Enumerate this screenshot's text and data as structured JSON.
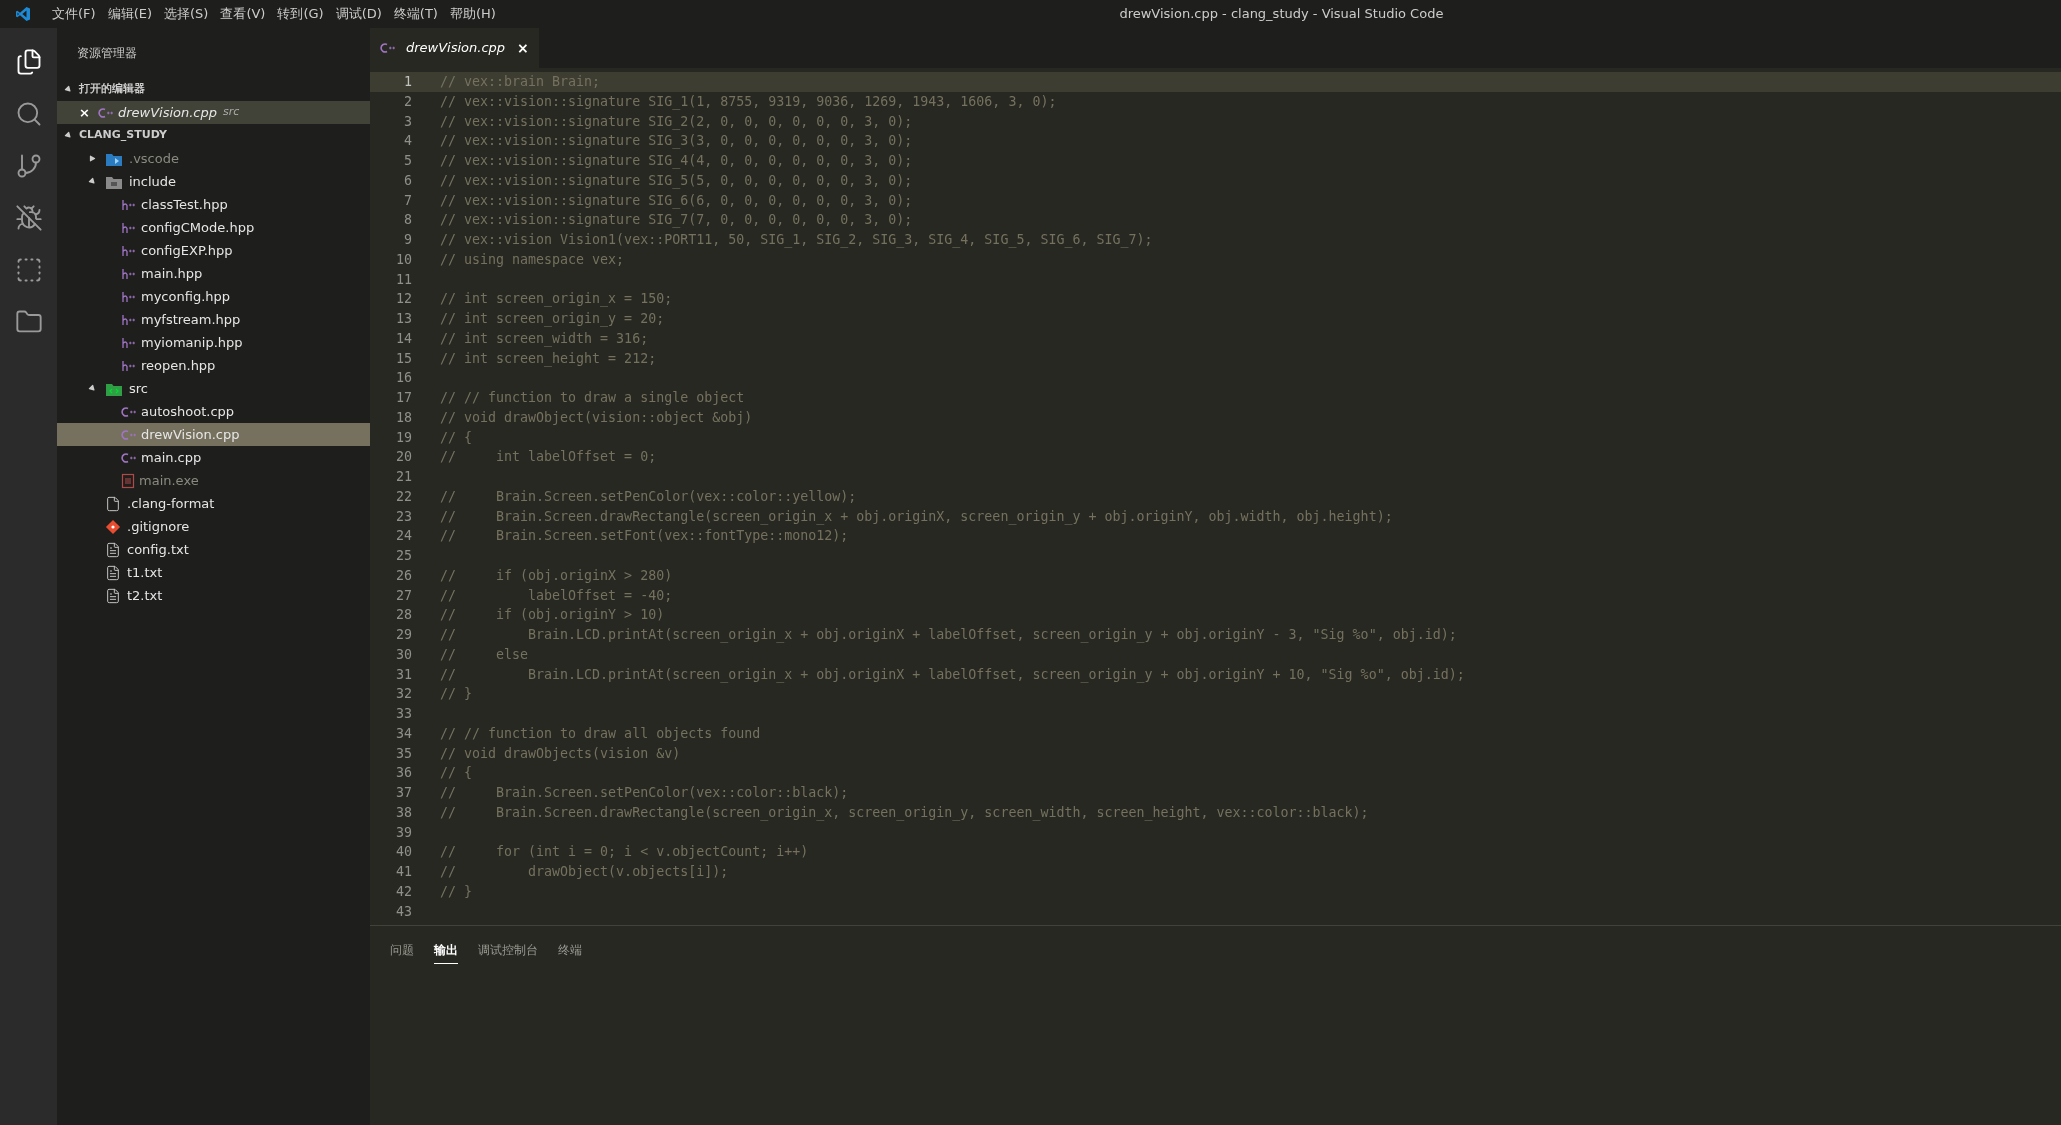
{
  "window": {
    "title": "drewVision.cpp - clang_study - Visual Studio Code"
  },
  "menu": [
    "文件(F)",
    "编辑(E)",
    "选择(S)",
    "查看(V)",
    "转到(G)",
    "调试(D)",
    "终端(T)",
    "帮助(H)"
  ],
  "activity_bar": [
    {
      "kind": "explorer",
      "selected": true
    },
    {
      "kind": "search",
      "selected": false
    },
    {
      "kind": "scm",
      "selected": false
    },
    {
      "kind": "debug",
      "selected": false
    },
    {
      "kind": "extensions",
      "selected": false
    },
    {
      "kind": "folder",
      "selected": false
    }
  ],
  "sidebar": {
    "title": "资源管理器",
    "open_editors": {
      "label": "打开的编辑器",
      "expanded": true,
      "items": [
        {
          "kind": "cpp",
          "name": "drewVision.cpp",
          "folder": "src",
          "close": "×"
        }
      ]
    },
    "project": {
      "label": "CLANG_STUDY",
      "expanded": true,
      "items": [
        {
          "kind": "vscode",
          "name": ".vscode",
          "expanded": false,
          "dim": true,
          "selected": false
        },
        {
          "kind": "folder",
          "name": "include",
          "expanded": true,
          "dim": false,
          "selected": false,
          "children": [
            {
              "kind": "hpp",
              "name": "classTest.hpp",
              "dim": false,
              "selected": false
            },
            {
              "kind": "hpp",
              "name": "configCMode.hpp",
              "dim": false,
              "selected": false
            },
            {
              "kind": "hpp",
              "name": "configEXP.hpp",
              "dim": false,
              "selected": false
            },
            {
              "kind": "hpp",
              "name": "main.hpp",
              "dim": false,
              "selected": false
            },
            {
              "kind": "hpp",
              "name": "myconfig.hpp",
              "dim": false,
              "selected": false
            },
            {
              "kind": "hpp",
              "name": "myfstream.hpp",
              "dim": false,
              "selected": false
            },
            {
              "kind": "hpp",
              "name": "myiomanip.hpp",
              "dim": false,
              "selected": false
            },
            {
              "kind": "hpp",
              "name": "reopen.hpp",
              "dim": false,
              "selected": false
            }
          ]
        },
        {
          "kind": "src",
          "name": "src",
          "expanded": true,
          "dim": false,
          "selected": false,
          "children": [
            {
              "kind": "cpp",
              "name": "autoshoot.cpp",
              "dim": false,
              "selected": false
            },
            {
              "kind": "cpp",
              "name": "drewVision.cpp",
              "dim": false,
              "selected": true
            },
            {
              "kind": "cpp",
              "name": "main.cpp",
              "dim": false,
              "selected": false
            },
            {
              "kind": "exe",
              "name": "main.exe",
              "dim": true,
              "selected": false
            }
          ]
        },
        {
          "kind": "file",
          "name": ".clang-format",
          "dim": false,
          "selected": false
        },
        {
          "kind": "git",
          "name": ".gitignore",
          "dim": false,
          "selected": false
        },
        {
          "kind": "txt",
          "name": "config.txt",
          "dim": false,
          "selected": false
        },
        {
          "kind": "txt",
          "name": "t1.txt",
          "dim": false,
          "selected": false
        },
        {
          "kind": "txt",
          "name": "t2.txt",
          "dim": false,
          "selected": false
        }
      ]
    }
  },
  "editor_tabs": [
    {
      "kind": "cpp",
      "label": "drewVision.cpp",
      "close": "×",
      "selected": true
    }
  ],
  "editor": {
    "lines": [
      {
        "number": "1",
        "text": "// vex::brain Brain;",
        "current": true
      },
      {
        "number": "2",
        "text": "// vex::vision::signature SIG_1(1, 8755, 9319, 9036, 1269, 1943, 1606, 3, 0);",
        "current": false
      },
      {
        "number": "3",
        "text": "// vex::vision::signature SIG_2(2, 0, 0, 0, 0, 0, 0, 3, 0);",
        "current": false
      },
      {
        "number": "4",
        "text": "// vex::vision::signature SIG_3(3, 0, 0, 0, 0, 0, 0, 3, 0);",
        "current": false
      },
      {
        "number": "5",
        "text": "// vex::vision::signature SIG_4(4, 0, 0, 0, 0, 0, 0, 3, 0);",
        "current": false
      },
      {
        "number": "6",
        "text": "// vex::vision::signature SIG_5(5, 0, 0, 0, 0, 0, 0, 3, 0);",
        "current": false
      },
      {
        "number": "7",
        "text": "// vex::vision::signature SIG_6(6, 0, 0, 0, 0, 0, 0, 3, 0);",
        "current": false
      },
      {
        "number": "8",
        "text": "// vex::vision::signature SIG_7(7, 0, 0, 0, 0, 0, 0, 3, 0);",
        "current": false
      },
      {
        "number": "9",
        "text": "// vex::vision Vision1(vex::PORT11, 50, SIG_1, SIG_2, SIG_3, SIG_4, SIG_5, SIG_6, SIG_7);",
        "current": false
      },
      {
        "number": "10",
        "text": "// using namespace vex;",
        "current": false
      },
      {
        "number": "11",
        "current": false
      },
      {
        "number": "12",
        "text": "// int screen_origin_x = 150;",
        "current": false
      },
      {
        "number": "13",
        "text": "// int screen_origin_y = 20;",
        "current": false
      },
      {
        "number": "14",
        "text": "// int screen_width = 316;",
        "current": false
      },
      {
        "number": "15",
        "text": "// int screen_height = 212;",
        "current": false
      },
      {
        "number": "16",
        "current": false
      },
      {
        "number": "17",
        "text": "// // function to draw a single object",
        "current": false
      },
      {
        "number": "18",
        "text": "// void drawObject(vision::object &obj)",
        "current": false
      },
      {
        "number": "19",
        "text": "// {",
        "current": false
      },
      {
        "number": "20",
        "text": "//     int labelOffset = 0;",
        "current": false
      },
      {
        "number": "21",
        "current": false
      },
      {
        "number": "22",
        "text": "//     Brain.Screen.setPenColor(vex::color::yellow);",
        "current": false
      },
      {
        "number": "23",
        "text": "//     Brain.Screen.drawRectangle(screen_origin_x + obj.originX, screen_origin_y + obj.originY, obj.width, obj.height);",
        "current": false
      },
      {
        "number": "24",
        "text": "//     Brain.Screen.setFont(vex::fontType::mono12);",
        "current": false
      },
      {
        "number": "25",
        "current": false
      },
      {
        "number": "26",
        "text": "//     if (obj.originX > 280)",
        "current": false
      },
      {
        "number": "27",
        "text": "//         labelOffset = -40;",
        "current": false
      },
      {
        "number": "28",
        "text": "//     if (obj.originY > 10)",
        "current": false
      },
      {
        "number": "29",
        "text": "//         Brain.LCD.printAt(screen_origin_x + obj.originX + labelOffset, screen_origin_y + obj.originY - 3, \"Sig %o\", obj.id);",
        "current": false
      },
      {
        "number": "30",
        "text": "//     else",
        "current": false
      },
      {
        "number": "31",
        "text": "//         Brain.LCD.printAt(screen_origin_x + obj.originX + labelOffset, screen_origin_y + obj.originY + 10, \"Sig %o\", obj.id);",
        "current": false
      },
      {
        "number": "32",
        "text": "// }",
        "current": false
      },
      {
        "number": "33",
        "current": false
      },
      {
        "number": "34",
        "text": "// // function to draw all objects found",
        "current": false
      },
      {
        "number": "35",
        "text": "// void drawObjects(vision &v)",
        "current": false
      },
      {
        "number": "36",
        "text": "// {",
        "current": false
      },
      {
        "number": "37",
        "text": "//     Brain.Screen.setPenColor(vex::color::black);",
        "current": false
      },
      {
        "number": "38",
        "text": "//     Brain.Screen.drawRectangle(screen_origin_x, screen_origin_y, screen_width, screen_height, vex::color::black);",
        "current": false
      },
      {
        "number": "39",
        "current": false
      },
      {
        "number": "40",
        "text": "//     for (int i = 0; i < v.objectCount; i++)",
        "current": false
      },
      {
        "number": "41",
        "text": "//         drawObject(v.objects[i]);",
        "current": false
      },
      {
        "number": "42",
        "text": "// }",
        "current": false
      },
      {
        "number": "43",
        "current": false
      }
    ]
  },
  "panel": {
    "tabs": [
      {
        "label": "问题",
        "selected": false
      },
      {
        "label": "输出",
        "selected": true
      },
      {
        "label": "调试控制台",
        "selected": false
      },
      {
        "label": "终端",
        "selected": false
      }
    ]
  }
}
